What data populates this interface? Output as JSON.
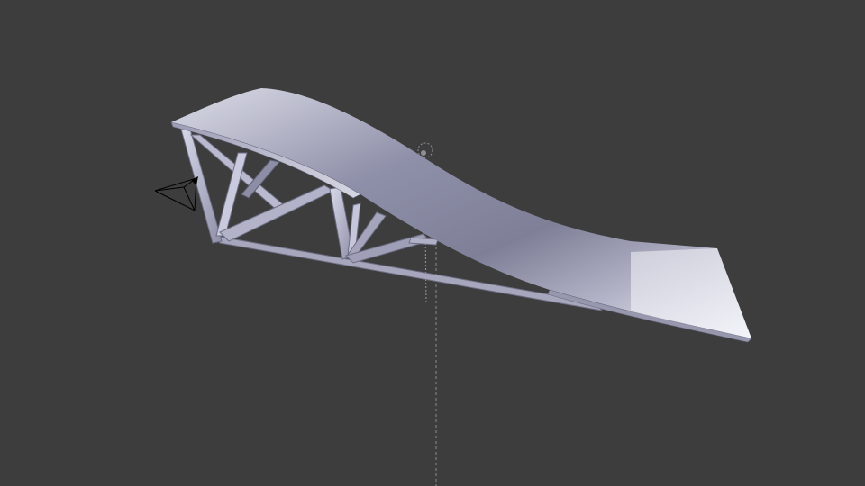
{
  "viewport": {
    "background_color": "#3d3d3d",
    "scene_object": "ramp",
    "camera_icon": "camera-icon",
    "origin_marker": "object-origin",
    "colors": {
      "deck_top": "#e7e8f0",
      "deck_mid": "#9a9bb3",
      "deck_shadow": "#6c6d82",
      "frame_light": "#cfd0e2",
      "frame_dark": "#8c8da6",
      "camera_wire": "#000000",
      "guide_line": "#9a9a9a"
    }
  }
}
